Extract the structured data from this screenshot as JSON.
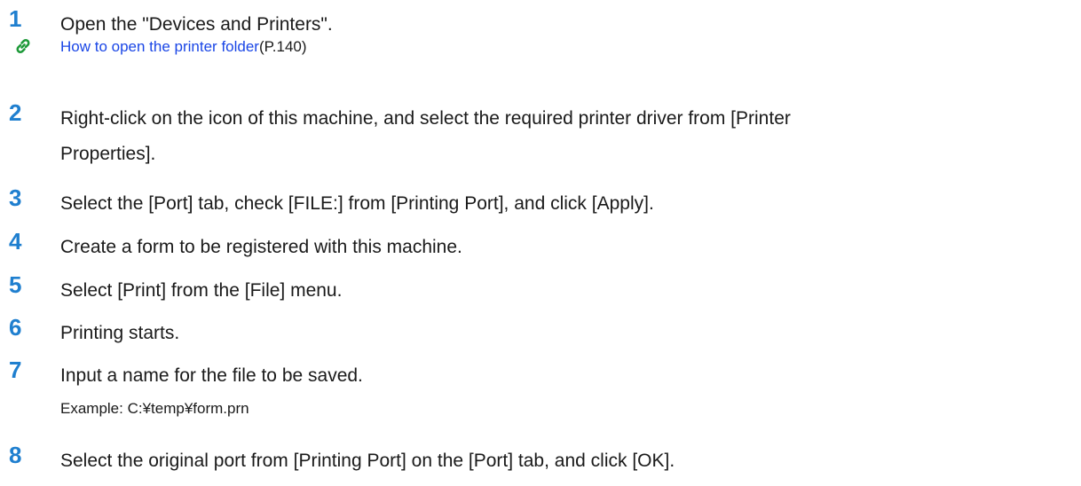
{
  "steps": [
    {
      "number": "1",
      "text": "Open the \"Devices and Printers\".",
      "link": {
        "icon": "chain-link-icon",
        "label": "How to open the printer folder",
        "page": "(P.140)"
      }
    },
    {
      "number": "2",
      "text_line1": "Right-click on the icon of this machine, and select the required printer driver from [Printer",
      "text_line2": "Properties]."
    },
    {
      "number": "3",
      "text": "Select the [Port] tab, check [FILE:] from [Printing Port], and click [Apply]."
    },
    {
      "number": "4",
      "text": "Create a form to be registered with this machine."
    },
    {
      "number": "5",
      "text": "Select [Print] from the [File] menu."
    },
    {
      "number": "6",
      "text": "Printing starts."
    },
    {
      "number": "7",
      "text": "Input a name for the file to be saved.",
      "example": "Example: C:¥temp¥form.prn"
    },
    {
      "number": "8",
      "text": "Select the original port from [Printing Port] on the [Port] tab, and click [OK]."
    }
  ],
  "colors": {
    "step_number": "#1f7fcf",
    "link": "#1a46e6",
    "body_text": "#1a1a1a"
  }
}
